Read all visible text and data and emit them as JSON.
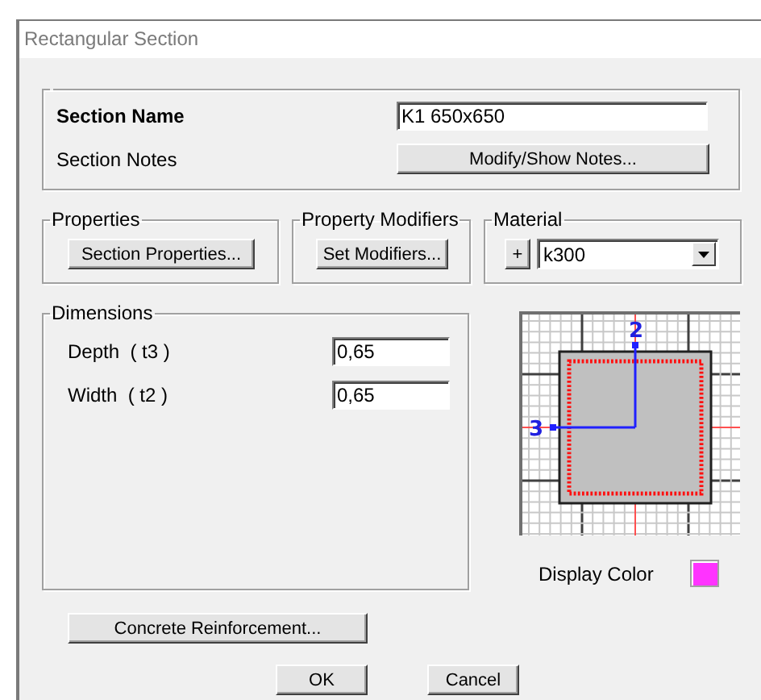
{
  "window": {
    "title": "Rectangular Section"
  },
  "section": {
    "name_label": "Section Name",
    "name_value": "K1 650x650",
    "notes_label": "Section Notes",
    "notes_button": "Modify/Show Notes..."
  },
  "properties": {
    "title": "Properties",
    "button": "Section Properties..."
  },
  "property_modifiers": {
    "title": "Property Modifiers",
    "button": "Set Modifiers..."
  },
  "material": {
    "title": "Material",
    "add_button": "+",
    "value": "k300"
  },
  "dimensions": {
    "title": "Dimensions",
    "fields": [
      {
        "label": "Depth  ( t3 )",
        "value": "0,65"
      },
      {
        "label": "Width  ( t2 )",
        "value": "0,65"
      }
    ]
  },
  "preview": {
    "axis_labels": [
      "2",
      "3"
    ]
  },
  "display_color": {
    "label": "Display Color",
    "color": "#ff33ff"
  },
  "buttons": [
    {
      "label": "Concrete Reinforcement..."
    },
    {
      "label": "OK"
    },
    {
      "label": "Cancel"
    }
  ]
}
